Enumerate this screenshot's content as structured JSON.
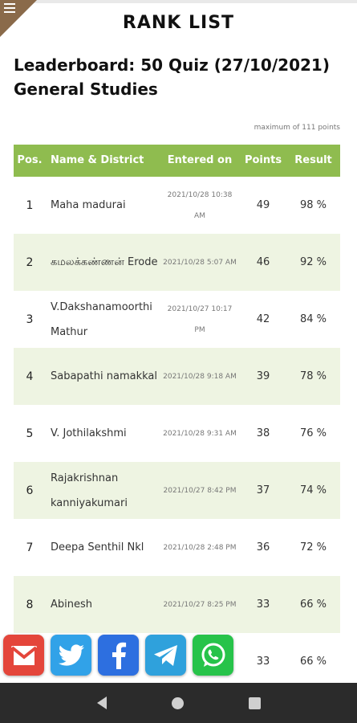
{
  "header": {
    "menu_icon": "hamburger-menu-icon",
    "title": "RANK LIST"
  },
  "leaderboard": {
    "title": "Leaderboard: 50 Quiz (27/10/2021) General Studies",
    "max_note": "maximum of 111 points"
  },
  "table": {
    "columns": {
      "pos": "Pos.",
      "name": "Name & District",
      "entered": "Entered on",
      "points": "Points",
      "result": "Result"
    },
    "rows": [
      {
        "pos": "1",
        "name": "Maha madurai",
        "entered": "2021/10/28 10:38 AM",
        "points": "49",
        "result": "98 %"
      },
      {
        "pos": "2",
        "name": "கமலக்கண்ணன் Erode",
        "entered": "2021/10/28 5:07 AM",
        "points": "46",
        "result": "92 %"
      },
      {
        "pos": "3",
        "name": "V.Dakshanamoorthi Mathur",
        "entered": "2021/10/27 10:17 PM",
        "points": "42",
        "result": "84 %"
      },
      {
        "pos": "4",
        "name": "Sabapathi namakkal",
        "entered": "2021/10/28 9:18 AM",
        "points": "39",
        "result": "78 %"
      },
      {
        "pos": "5",
        "name": "V. Jothilakshmi",
        "entered": "2021/10/28 9:31 AM",
        "points": "38",
        "result": "76 %"
      },
      {
        "pos": "6",
        "name": "Rajakrishnan kanniyakumari",
        "entered": "2021/10/27 8:42 PM",
        "points": "37",
        "result": "74 %"
      },
      {
        "pos": "7",
        "name": "Deepa Senthil Nkl",
        "entered": "2021/10/28 2:48 PM",
        "points": "36",
        "result": "72 %"
      },
      {
        "pos": "8",
        "name": "Abinesh",
        "entered": "2021/10/27 8:25 PM",
        "points": "33",
        "result": "66 %"
      },
      {
        "pos": "",
        "name": "",
        "entered": "",
        "points": "33",
        "result": "66 %"
      }
    ]
  },
  "share": {
    "icons": [
      "gmail-icon",
      "twitter-icon",
      "facebook-icon",
      "telegram-icon",
      "whatsapp-icon"
    ]
  },
  "navbar": {
    "icons": [
      "back-icon",
      "home-icon",
      "recent-apps-icon"
    ]
  },
  "colors": {
    "header_green": "#8fbc4f",
    "row_alt": "#eef4e2",
    "corner_brown": "#8a6a4a",
    "navbar": "#2b2b2b"
  }
}
